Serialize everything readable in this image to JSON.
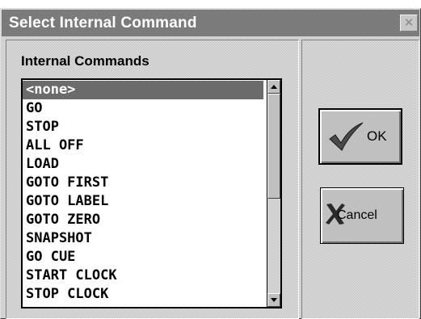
{
  "window": {
    "title": "Select Internal Command",
    "close_symbol": "✕"
  },
  "list": {
    "heading": "Internal Commands",
    "selected_index": 0,
    "items": [
      "<none>",
      "GO",
      "STOP",
      "ALL OFF",
      "LOAD",
      "GOTO FIRST",
      "GOTO LABEL",
      "GOTO ZERO",
      "SNAPSHOT",
      "GO CUE",
      "START CLOCK",
      "STOP CLOCK"
    ]
  },
  "buttons": {
    "ok_label": "OK",
    "cancel_label": "Cancel"
  },
  "icons": {
    "ok": "checkmark-icon",
    "cancel": "x-icon",
    "close": "close-icon"
  },
  "colors": {
    "title_bar": "#7b7b7b",
    "selection": "#6b6b6b",
    "face": "#c0c0c0"
  }
}
